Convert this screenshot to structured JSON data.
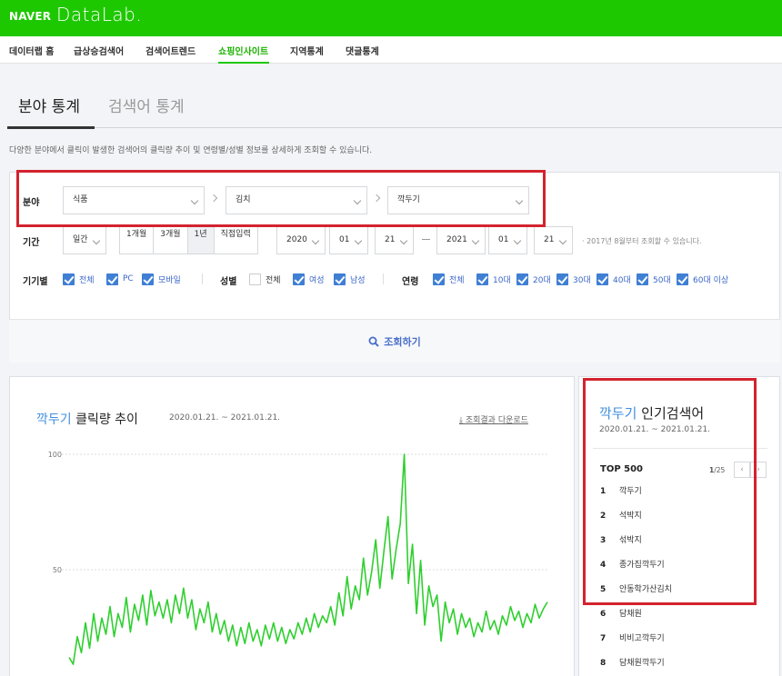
{
  "header": {
    "brand": "NAVER",
    "product": "DataLab."
  },
  "nav": {
    "items": [
      {
        "label": "데이터랩 홈",
        "active": false
      },
      {
        "label": "급상승검색어",
        "active": false
      },
      {
        "label": "검색어트렌드",
        "active": false
      },
      {
        "label": "쇼핑인사이트",
        "active": true
      },
      {
        "label": "지역통계",
        "active": false
      },
      {
        "label": "댓글통계",
        "active": false
      }
    ]
  },
  "tabs": {
    "active": "분야 통계",
    "inactive": "검색어 통계"
  },
  "description": "다양한 분야에서 클릭이 발생한 검색어의 클릭량 추이 및 연령별/성별 정보를 상세하게 조회할 수 있습니다.",
  "filters": {
    "category_label": "분야",
    "category": [
      "식품",
      "김치",
      "깍두기"
    ],
    "period_label": "기간",
    "period_unit": "일간",
    "period_presets": [
      "1개월",
      "3개월",
      "1년",
      "직접입력"
    ],
    "period_selected": "1년",
    "start": {
      "year": "2020",
      "month": "01",
      "day": "21"
    },
    "end": {
      "year": "2021",
      "month": "01",
      "day": "21"
    },
    "date_note": "· 2017년 8월부터 조회할 수 있습니다.",
    "device_label": "기기별",
    "devices": [
      {
        "label": "전체",
        "checked": true
      },
      {
        "label": "PC",
        "checked": true
      },
      {
        "label": "모바일",
        "checked": true
      }
    ],
    "gender_label": "성별",
    "genders": [
      {
        "label": "전체",
        "checked": false
      },
      {
        "label": "여성",
        "checked": true
      },
      {
        "label": "남성",
        "checked": true
      }
    ],
    "age_label": "연령",
    "ages": [
      {
        "label": "전체",
        "checked": true
      },
      {
        "label": "10대",
        "checked": true
      },
      {
        "label": "20대",
        "checked": true
      },
      {
        "label": "30대",
        "checked": true
      },
      {
        "label": "40대",
        "checked": true
      },
      {
        "label": "50대",
        "checked": true
      },
      {
        "label": "60대 이상",
        "checked": true
      }
    ],
    "search_button": "조회하기"
  },
  "chart_panel": {
    "keyword": "깍두기",
    "title_rest": " 클릭량 추이",
    "period": "2020.01.21. ~ 2021.01.21.",
    "download": "조회결과 다운로드"
  },
  "chart_data": {
    "type": "line",
    "series": [
      {
        "color": "#2fcf2f",
        "values": [
          12,
          9,
          21,
          14,
          27,
          16,
          31,
          19,
          29,
          22,
          34,
          21,
          31,
          25,
          38,
          23,
          35,
          28,
          39,
          26,
          41,
          30,
          36,
          29,
          37,
          27,
          39,
          31,
          42,
          29,
          37,
          24,
          33,
          27,
          36,
          23,
          31,
          22,
          28,
          19,
          26,
          17,
          25,
          18,
          27,
          19,
          24,
          17,
          26,
          20,
          27,
          19,
          25,
          18,
          24,
          20,
          27,
          22,
          29,
          23,
          31,
          25,
          30,
          27,
          34,
          26,
          40,
          30,
          47,
          33,
          43,
          37,
          55,
          39,
          49,
          63,
          42,
          58,
          73,
          46,
          59,
          70,
          100,
          44,
          61,
          31,
          54,
          26,
          43,
          34,
          39,
          19,
          36,
          27,
          33,
          22,
          31,
          25,
          29,
          21,
          27,
          23,
          32,
          24,
          28,
          22,
          30,
          26,
          34,
          28,
          32,
          25,
          31,
          27,
          35,
          29,
          33,
          36
        ]
      }
    ],
    "yticks": [
      50,
      100
    ],
    "ylim": [
      0,
      100
    ],
    "grid": true
  },
  "ranking": {
    "keyword": "깍두기",
    "title_rest": " 인기검색어",
    "period": "2020.01.21. ~ 2021.01.21.",
    "top_label": "TOP 500",
    "page_current": "1",
    "page_total": "/25",
    "items": [
      {
        "rank": "1",
        "label": "깍두기"
      },
      {
        "rank": "2",
        "label": "석박지"
      },
      {
        "rank": "3",
        "label": "섞박지"
      },
      {
        "rank": "4",
        "label": "종가집깍두기"
      },
      {
        "rank": "5",
        "label": "안동학가산김치"
      },
      {
        "rank": "6",
        "label": "담채원"
      },
      {
        "rank": "7",
        "label": "비비고깍두기"
      },
      {
        "rank": "8",
        "label": "담채원깍두기"
      }
    ]
  },
  "colors": {
    "brand_green": "#1ec800",
    "accent_blue": "#3f8fdd",
    "check_blue": "#3f7fd4",
    "highlight_red": "#d3232f",
    "line_green": "#2fcf2f"
  }
}
